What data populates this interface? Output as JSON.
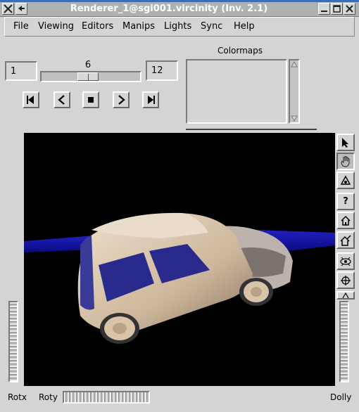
{
  "window": {
    "title": "Renderer_1@sgi001.vircinity (Inv. 2.1)"
  },
  "menu": {
    "items": [
      "File",
      "Viewing",
      "Editors",
      "Manips",
      "Lights",
      "Sync",
      "Help"
    ]
  },
  "timestep": {
    "min": "1",
    "current": "6",
    "max": "12"
  },
  "colormaps": {
    "label": "Colormaps"
  },
  "viewer": {
    "left_wheel_label": "Rotx",
    "bottom_wheel_label": "Roty",
    "right_wheel_label": "Dolly"
  },
  "colors": {
    "car_body": "#d8c4ac",
    "windows": "#2a2a8c",
    "floor": "#141496",
    "background": "#000000"
  },
  "icons": {
    "side_buttons": [
      "pointer-icon",
      "hand-icon",
      "perspective-icon",
      "help-icon",
      "home-icon",
      "set-home-icon",
      "view-all-icon",
      "seek-icon",
      "projection-icon"
    ],
    "nav_buttons": [
      "first-frame-icon",
      "step-back-icon",
      "stop-icon",
      "step-forward-icon",
      "last-frame-icon"
    ]
  }
}
